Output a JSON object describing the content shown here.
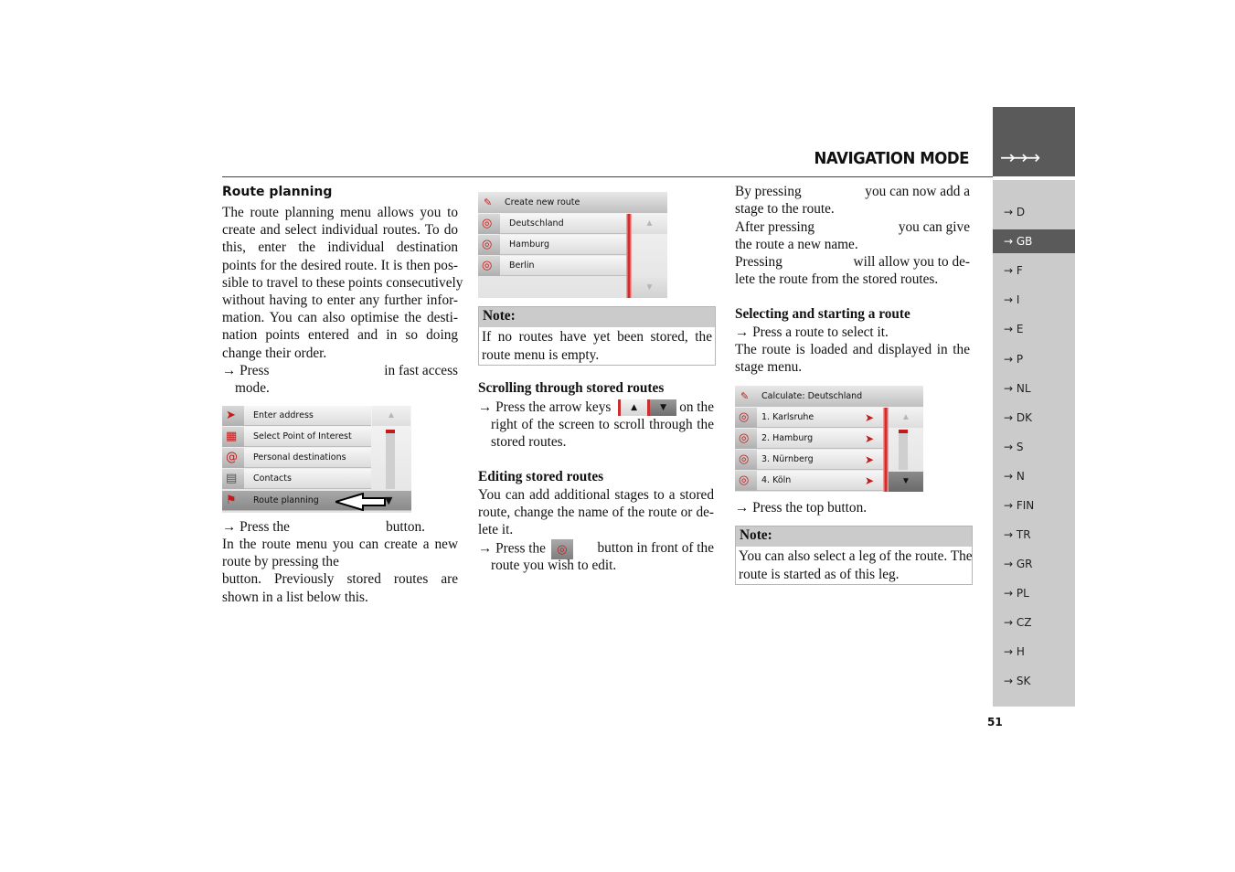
{
  "header": {
    "title": "NAVIGATION MODE",
    "arrows": "→→→"
  },
  "sidebar": {
    "languages": [
      {
        "label": "→ D",
        "active": false
      },
      {
        "label": "→ GB",
        "active": true
      },
      {
        "label": "→ F",
        "active": false
      },
      {
        "label": "→ I",
        "active": false
      },
      {
        "label": "→ E",
        "active": false
      },
      {
        "label": "→ P",
        "active": false
      },
      {
        "label": "→ NL",
        "active": false
      },
      {
        "label": "→ DK",
        "active": false
      },
      {
        "label": "→ S",
        "active": false
      },
      {
        "label": "→ N",
        "active": false
      },
      {
        "label": "→ FIN",
        "active": false
      },
      {
        "label": "→ TR",
        "active": false
      },
      {
        "label": "→ GR",
        "active": false
      },
      {
        "label": "→ PL",
        "active": false
      },
      {
        "label": "→ CZ",
        "active": false
      },
      {
        "label": "→ H",
        "active": false
      },
      {
        "label": "→ SK",
        "active": false
      }
    ]
  },
  "page_number": "51",
  "col1": {
    "heading": "Route planning",
    "intro_lines": [
      "The route planning menu allows you to",
      "create and select individual routes. To do",
      "this, enter the individual destination",
      "points for the desired route. It is then pos-",
      "sible to travel to these points consecutively",
      "without having to enter any further infor-",
      "mation. You can also optimise the desti-",
      "nation points entered and in so doing",
      "change their order."
    ],
    "press_fast_access": {
      "prefix": "→ Press",
      "suffix": "in fast access",
      "line2": "mode."
    },
    "fast_menu": {
      "items": [
        {
          "label": "Enter address",
          "icon": "➤"
        },
        {
          "label": "Select Point of Interest",
          "icon": "▦"
        },
        {
          "label": "Personal destinations",
          "icon": "@"
        },
        {
          "label": "Contacts",
          "icon": "▤"
        },
        {
          "label": "Route planning",
          "icon": "⚑"
        }
      ],
      "scroll_up": "▲",
      "scroll_down": "▼"
    },
    "press_button": {
      "prefix": "→ Press the",
      "suffix": "button."
    },
    "outro_lines": [
      "In the route menu you can create a new",
      "route by pressing the",
      "button. Previously stored routes are",
      "shown in a list below this."
    ]
  },
  "col2": {
    "route_menu": {
      "title": "Create new route",
      "routes": [
        "Deutschland",
        "Hamburg",
        "Berlin"
      ],
      "scroll_up": "▲",
      "scroll_down": "▼"
    },
    "note1": {
      "head": "Note:",
      "lines": [
        "If no routes have yet been stored, the",
        "route menu is empty."
      ]
    },
    "scrolling": {
      "heading": "Scrolling through stored routes",
      "line1_prefix": "→ Press the arrow keys",
      "key_up": "▲",
      "key_down": "▼",
      "line1_suffix": "on the",
      "lines": [
        "right of the screen to scroll through the",
        "stored routes."
      ]
    },
    "editing": {
      "heading": "Editing stored routes",
      "lines": [
        "You can add additional stages to a stored",
        "route, change the name of the route or de-",
        "lete it."
      ],
      "press_prefix": "→ Press the",
      "press_suffix": "button in front of the",
      "press_line2": "route you wish to edit."
    }
  },
  "col3": {
    "by_pressing": {
      "prefix": "By pressing",
      "suffix": "you can now add a",
      "line2": "stage to the route."
    },
    "after_pressing": {
      "prefix": "After pressing",
      "suffix": "you can give",
      "line2": "the route a new name."
    },
    "pressing": {
      "prefix": "Pressing",
      "suffix": "will allow you to de-",
      "line2": "lete the route from the stored routes."
    },
    "selecting": {
      "heading": "Selecting and starting a route",
      "step": "→ Press a route to select it.",
      "lines": [
        "The route is loaded and displayed in the",
        "stage menu."
      ]
    },
    "stage_menu": {
      "title": "Calculate: Deutschland",
      "stages": [
        "1. Karlsruhe",
        "2. Hamburg",
        "3. Nürnberg",
        "4. Köln"
      ],
      "scroll_up": "▲",
      "scroll_down": "▼"
    },
    "press_top": "→ Press the top button.",
    "note2": {
      "head": "Note:",
      "lines": [
        "You can also select a leg of the route. The",
        "route is started as of this leg."
      ]
    }
  }
}
